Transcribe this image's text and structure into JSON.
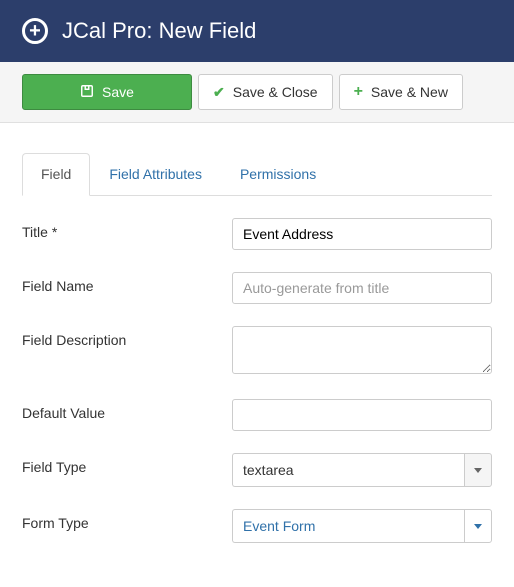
{
  "header": {
    "title": "JCal Pro: New Field"
  },
  "toolbar": {
    "save_label": "Save",
    "save_close_label": "Save & Close",
    "save_new_label": "Save & New"
  },
  "tabs": {
    "field": "Field",
    "attributes": "Field Attributes",
    "permissions": "Permissions"
  },
  "form": {
    "title_label": "Title *",
    "title_value": "Event Address",
    "field_name_label": "Field Name",
    "field_name_placeholder": "Auto-generate from title",
    "field_name_value": "",
    "field_description_label": "Field Description",
    "field_description_value": "",
    "default_value_label": "Default Value",
    "default_value_value": "",
    "field_type_label": "Field Type",
    "field_type_value": "textarea",
    "form_type_label": "Form Type",
    "form_type_value": "Event Form"
  }
}
